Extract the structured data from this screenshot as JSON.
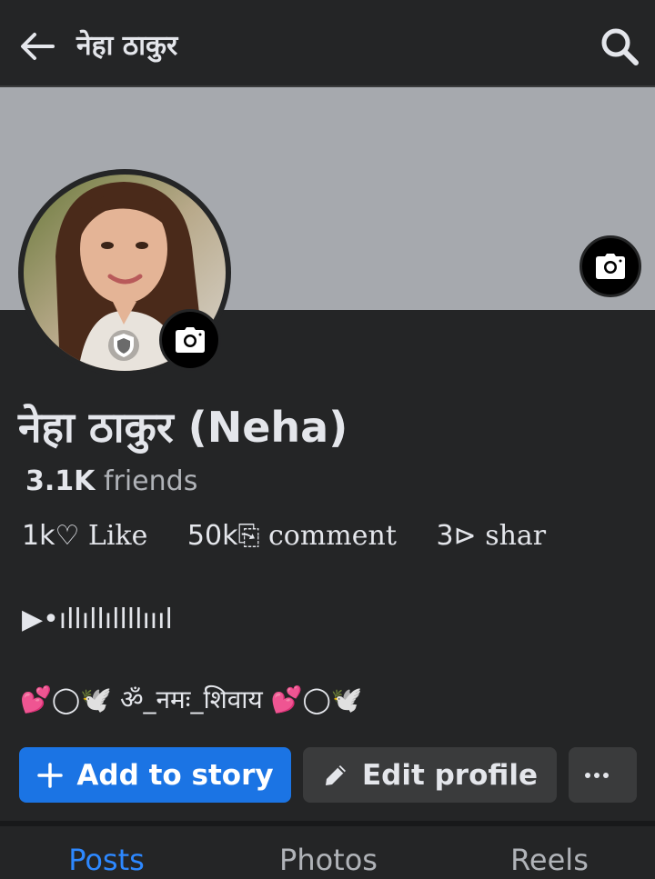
{
  "header": {
    "title": "नेहा ठाकुर"
  },
  "profile": {
    "name": "नेहा ठाकुर (Neha)",
    "friends_count": "3.1K",
    "friends_label": "friends"
  },
  "stats": {
    "likes_num": "1k",
    "likes_label": "♡ Like",
    "comments_num": "50k",
    "comments_label": "comment",
    "shares_num": "3",
    "shares_label": "⊳ shar"
  },
  "audio_line": "▶•ıllıllıllllıııl",
  "bio": "💕◯🕊️ ॐ_नमः_शिवाय 💕◯🕊️",
  "actions": {
    "add_story_label": "Add to story",
    "edit_profile_label": "Edit profile",
    "more_label": "···"
  },
  "tabs": [
    {
      "label": "Posts",
      "active": true
    },
    {
      "label": "Photos",
      "active": false
    },
    {
      "label": "Reels",
      "active": false
    }
  ],
  "colors": {
    "background": "#242526",
    "cover": "#a6a9ae",
    "primary_button": "#1b74e4",
    "secondary_button": "#3a3b3c",
    "active_tab": "#2d88ff"
  },
  "icons": [
    "back-arrow-icon",
    "search-icon",
    "camera-icon",
    "shield-icon",
    "plus-icon",
    "pencil-icon",
    "more-icon"
  ]
}
